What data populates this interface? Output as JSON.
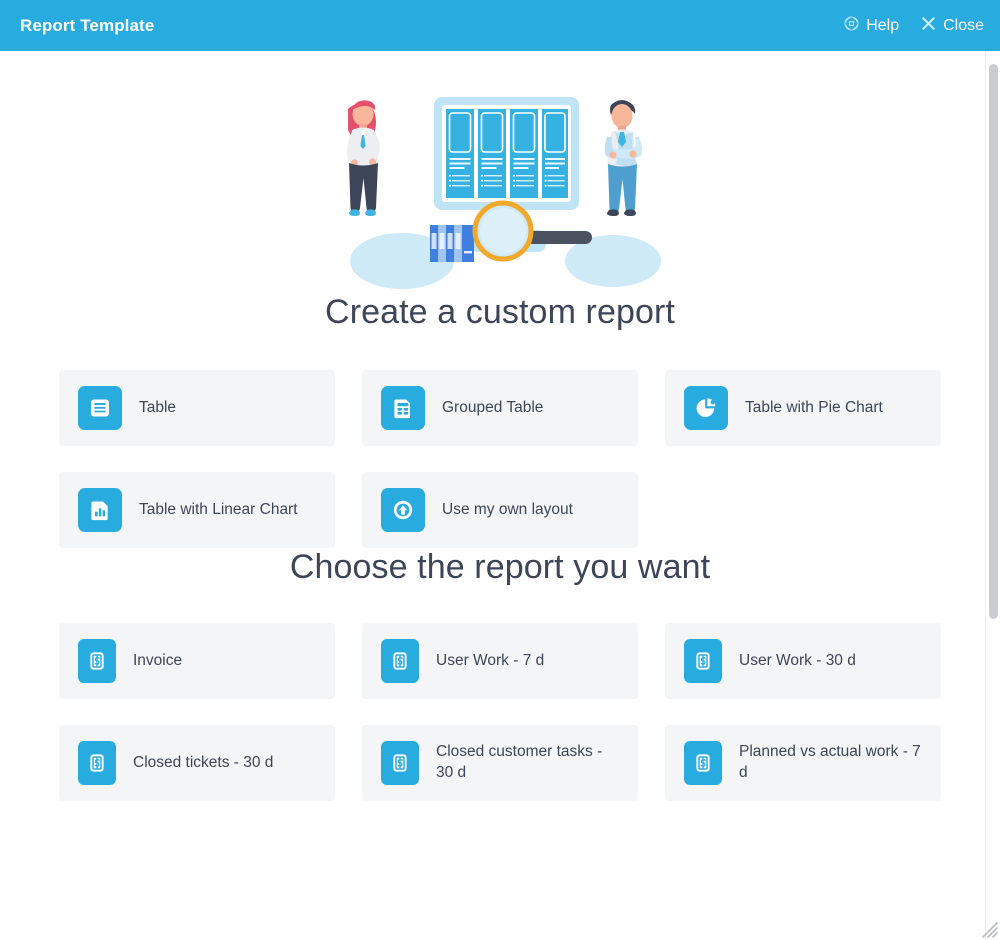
{
  "window": {
    "title": "Report Template",
    "actions": [
      {
        "label": "Help",
        "icon": "lifebuoy-icon"
      },
      {
        "label": "Close",
        "icon": "close-icon"
      }
    ]
  },
  "illustration": {
    "name": "report-dashboard-illustration",
    "alt": "Two people standing beside a dashboard screen with a magnifying glass, books and folders"
  },
  "sections": [
    {
      "id": "create-custom-report",
      "title": "Create a custom report",
      "cards": [
        {
          "label": "Table",
          "icon": "table-icon"
        },
        {
          "label": "Grouped Table",
          "icon": "grouped-table-icon"
        },
        {
          "label": "Table with Pie Chart",
          "icon": "pie-chart-icon"
        },
        {
          "label": "Table with Linear Chart",
          "icon": "document-bar-chart-icon"
        },
        {
          "label": "Use my own layout",
          "icon": "upload-circle-icon"
        }
      ]
    },
    {
      "id": "choose-report",
      "title": "Choose the report you want",
      "cards": [
        {
          "label": "Invoice",
          "icon": "invoice-icon"
        },
        {
          "label": "User Work - 7 d",
          "icon": "invoice-icon"
        },
        {
          "label": "User Work - 30 d",
          "icon": "invoice-icon"
        },
        {
          "label": "Closed tickets - 30 d",
          "icon": "invoice-icon"
        },
        {
          "label": "Closed customer tasks - 30 d",
          "icon": "invoice-icon"
        },
        {
          "label": "Planned vs actual work - 7 d",
          "icon": "invoice-icon"
        }
      ]
    }
  ],
  "scrollbar": {
    "name": "vertical-scrollbar",
    "thumb_position": "top"
  },
  "colors": {
    "accent": "#28ABDF",
    "card_bg": "#f4f5f6",
    "heading_text": "#3d4558",
    "titlebar_text": "#ffffff",
    "scrollbar_thumb": "#c8cdd2"
  }
}
